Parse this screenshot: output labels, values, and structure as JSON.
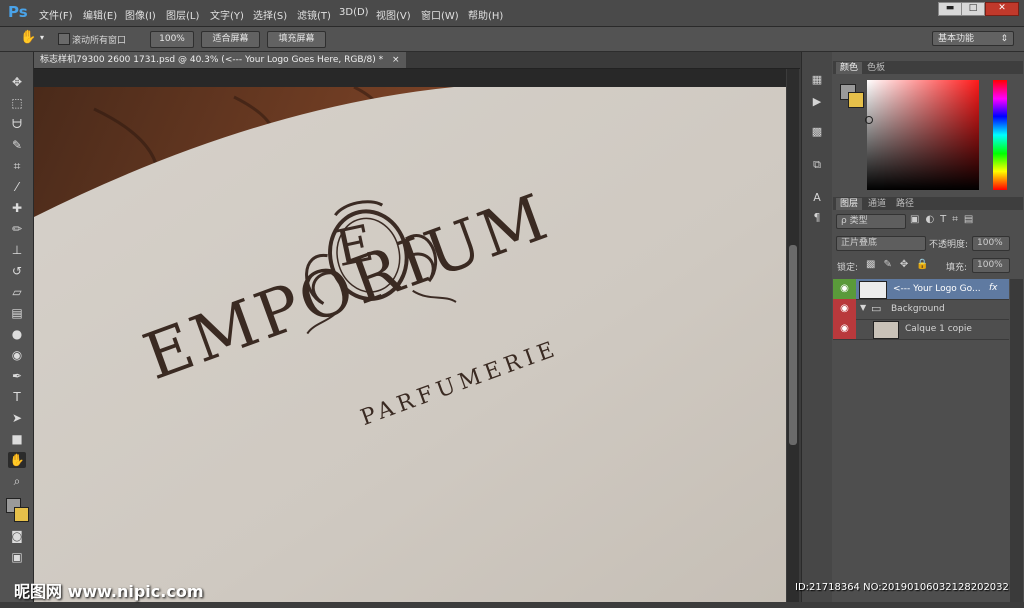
{
  "app": {
    "logo": "Ps"
  },
  "menu": [
    "文件(F)",
    "编辑(E)",
    "图像(I)",
    "图层(L)",
    "文字(Y)",
    "选择(S)",
    "滤镜(T)",
    "3D(D)",
    "视图(V)",
    "窗口(W)",
    "帮助(H)"
  ],
  "window_controls": {
    "minimize": "▬",
    "maximize": "□",
    "close": "✕"
  },
  "options": {
    "scroll_all_label": "滚动所有窗口",
    "zoom_100": "100%",
    "fit_screen": "适合屏幕",
    "fill_screen": "填充屏幕",
    "workspace": "基本功能"
  },
  "document": {
    "tab_title": "标志样机79300 2600 1731.psd @ 40.3% (<--- Your Logo Goes Here, RGB/8) *",
    "tab_close": "×"
  },
  "artwork": {
    "monogram": "E",
    "brand": "EMPORIUM",
    "tagline": "PARFUMERIE"
  },
  "color_panel": {
    "tabs": [
      "颜色",
      "色板"
    ],
    "fg_color": "#9a9a9a",
    "bg_color": "#e6c04a"
  },
  "layers_panel": {
    "tabs": [
      "图层",
      "通道",
      "路径"
    ],
    "filter_kind": "ρ 类型",
    "blend_mode": "正片叠底",
    "opacity_label": "不透明度:",
    "opacity_value": "100%",
    "lock_label": "锁定:",
    "fill_label": "填充:",
    "fill_value": "100%",
    "layers": [
      {
        "name": "<--- Your Logo Go...",
        "fx": "fx",
        "selected": true
      },
      {
        "name": "Background",
        "type": "group"
      },
      {
        "name": "Calque 1 copie"
      }
    ]
  },
  "watermark": {
    "site": "昵图网 www.nipic.com",
    "id": "ID:21718364 NO:20190106032128202032"
  }
}
